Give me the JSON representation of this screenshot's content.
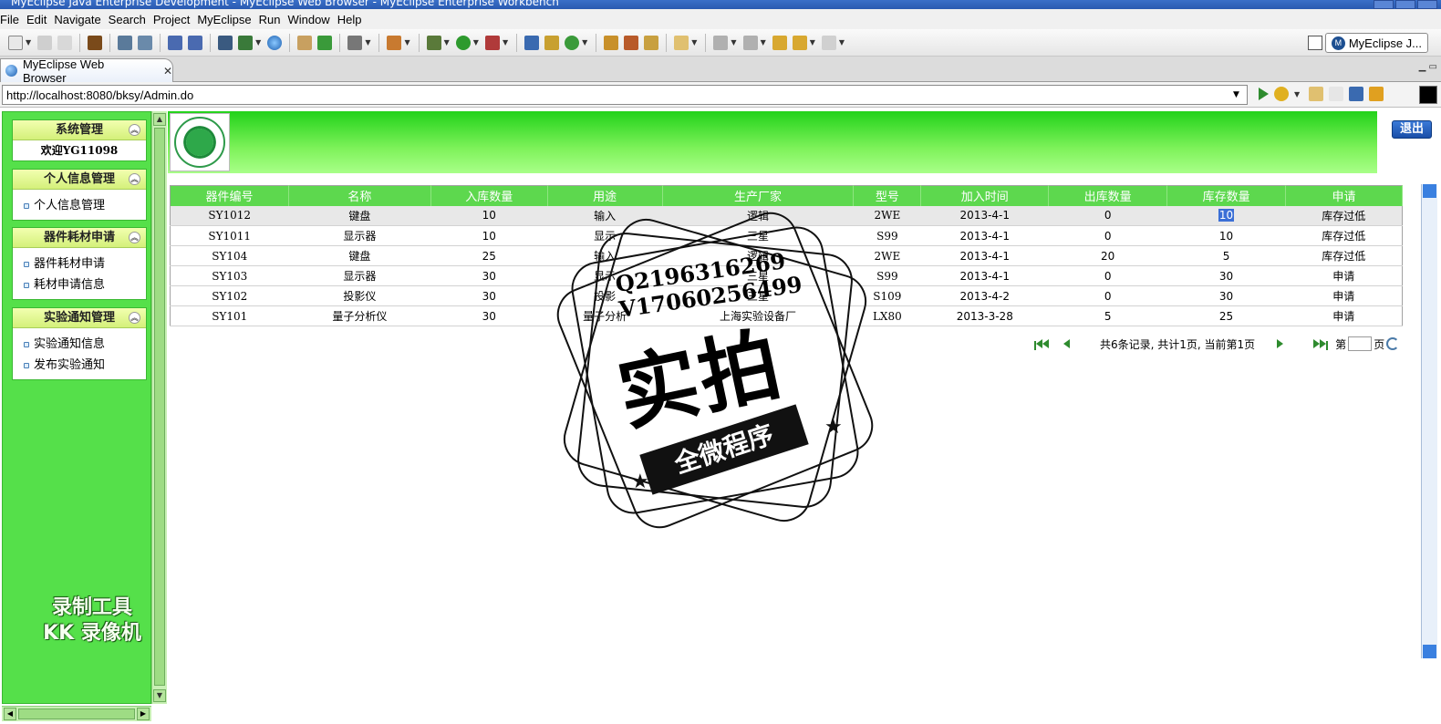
{
  "window": {
    "title": "MyEclipse Java Enterprise Development - MyEclipse Web Browser - MyEclipse Enterprise Workbench"
  },
  "menu": [
    "File",
    "Edit",
    "Navigate",
    "Search",
    "Project",
    "MyEclipse",
    "Run",
    "Window",
    "Help"
  ],
  "perspective": {
    "label": "MyEclipse J..."
  },
  "editor_tab": {
    "label": "MyEclipse Web Browser"
  },
  "browser": {
    "url": "http://localhost:8080/bksy/Admin.do"
  },
  "sidebar": {
    "groups": [
      {
        "title": "系统管理",
        "welcome": "欢迎YG11098",
        "items": []
      },
      {
        "title": "个人信息管理",
        "items": [
          "个人信息管理"
        ]
      },
      {
        "title": "器件耗材申请",
        "items": [
          "器件耗材申请",
          "耗材申请信息"
        ]
      },
      {
        "title": "实验通知管理",
        "items": [
          "实验通知信息",
          "发布实验通知"
        ]
      }
    ],
    "watermark": [
      "录制工具",
      "KK 录像机"
    ]
  },
  "header": {
    "logout_label": "退出"
  },
  "table": {
    "columns": [
      "器件编号",
      "名称",
      "入库数量",
      "用途",
      "生产厂家",
      "型号",
      "加入时间",
      "出库数量",
      "库存数量",
      "申请"
    ],
    "rows": [
      [
        "SY1012",
        "键盘",
        "10",
        "输入",
        "逻辑",
        "2WE",
        "2013-4-1",
        "0",
        "10",
        "库存过低"
      ],
      [
        "SY1011",
        "显示器",
        "10",
        "显示",
        "三星",
        "S99",
        "2013-4-1",
        "0",
        "10",
        "库存过低"
      ],
      [
        "SY104",
        "键盘",
        "25",
        "输入",
        "逻辑",
        "2WE",
        "2013-4-1",
        "20",
        "5",
        "库存过低"
      ],
      [
        "SY103",
        "显示器",
        "30",
        "显示",
        "三星",
        "S99",
        "2013-4-1",
        "0",
        "30",
        "申请"
      ],
      [
        "SY102",
        "投影仪",
        "30",
        "投影",
        "三星",
        "S109",
        "2013-4-2",
        "0",
        "30",
        "申请"
      ],
      [
        "SY101",
        "量子分析仪",
        "30",
        "量子分析",
        "上海实验设备厂",
        "LX80",
        "2013-3-28",
        "5",
        "25",
        "申请"
      ]
    ],
    "selected_row": 0
  },
  "pager": {
    "summary": "共6条记录, 共计1页, 当前第1页",
    "goto_prefix": "第",
    "goto_suffix": "页",
    "goto_value": ""
  },
  "stamp": {
    "contact_1": "Q2196316269",
    "contact_2": "V17060256499",
    "big_text": "实拍",
    "ribbon_text": "全微程序"
  }
}
